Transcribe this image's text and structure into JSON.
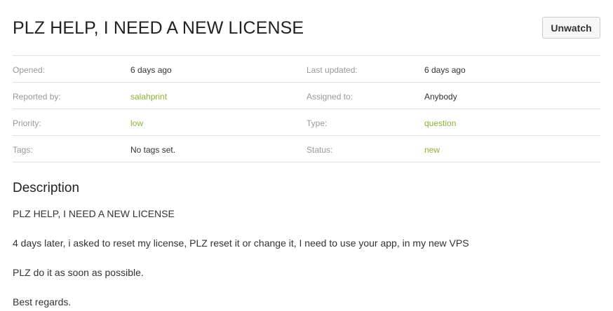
{
  "issue": {
    "title": "PLZ HELP, I NEED A NEW LICENSE",
    "watch_label": "Unwatch"
  },
  "meta": [
    {
      "left_label": "Opened:",
      "left_value": "6 days ago",
      "right_label": "Last updated:",
      "right_value": "6 days ago"
    },
    {
      "left_label": "Reported by:",
      "left_value": "salahprint",
      "right_label": "Assigned to:",
      "right_value": "Anybody"
    },
    {
      "left_label": "Priority:",
      "left_value": "low",
      "right_label": "Type:",
      "right_value": "question"
    },
    {
      "left_label": "Tags:",
      "left_value": "No tags set.",
      "right_label": "Status:",
      "right_value": "new"
    }
  ],
  "description": {
    "heading": "Description",
    "paragraphs": [
      "PLZ HELP, I NEED A NEW LICENSE",
      "4 days later, i asked to reset my license, PLZ reset it or change it, I need to use your app, in my new VPS",
      "PLZ do it as soon as possible.",
      "Best regards."
    ]
  },
  "colors": {
    "link": "#8db13b",
    "label": "#999999",
    "text": "#333333",
    "divider": "#e2e2e2"
  }
}
